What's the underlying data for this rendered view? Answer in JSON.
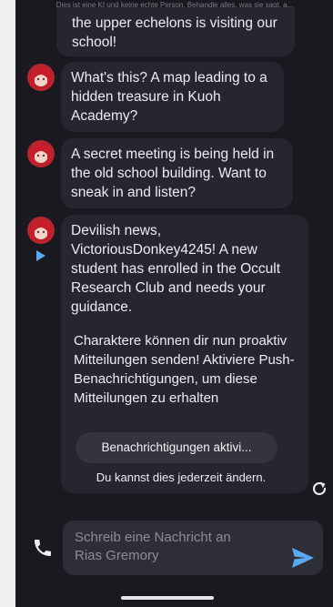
{
  "disclaimer": "Dies ist eine KI und keine echte Person. Behandle alles, was sie sagt, a...",
  "messages": [
    {
      "text": "the upper echelons is visiting our school!"
    },
    {
      "text": "What's this? A map leading to a hidden treasure in Kuoh Academy?"
    },
    {
      "text": "A secret meeting is being held in the old school building. Want to sneak in and listen?"
    },
    {
      "text": "Devilish news, VictoriousDonkey4245! A new student has enrolled in the Occult Research Club and needs your guidance."
    }
  ],
  "notification": {
    "text": "Charaktere können dir nun proaktiv Mitteilungen senden! Aktiviere Push-Benachrichtigungen, um diese Mitteilungen zu erhalten",
    "button_label": "Benachrichtigungen aktivi...",
    "footnote": "Du kannst dies jederzeit ändern."
  },
  "composer": {
    "placeholder": "Schreib eine Nachricht an Rias Gremory"
  },
  "colors": {
    "background": "#19191f",
    "bubble": "#26262e",
    "accent": "#5aa9f5"
  },
  "icons": [
    "avatar",
    "play-icon",
    "reload-icon",
    "phone-icon",
    "send-icon"
  ]
}
